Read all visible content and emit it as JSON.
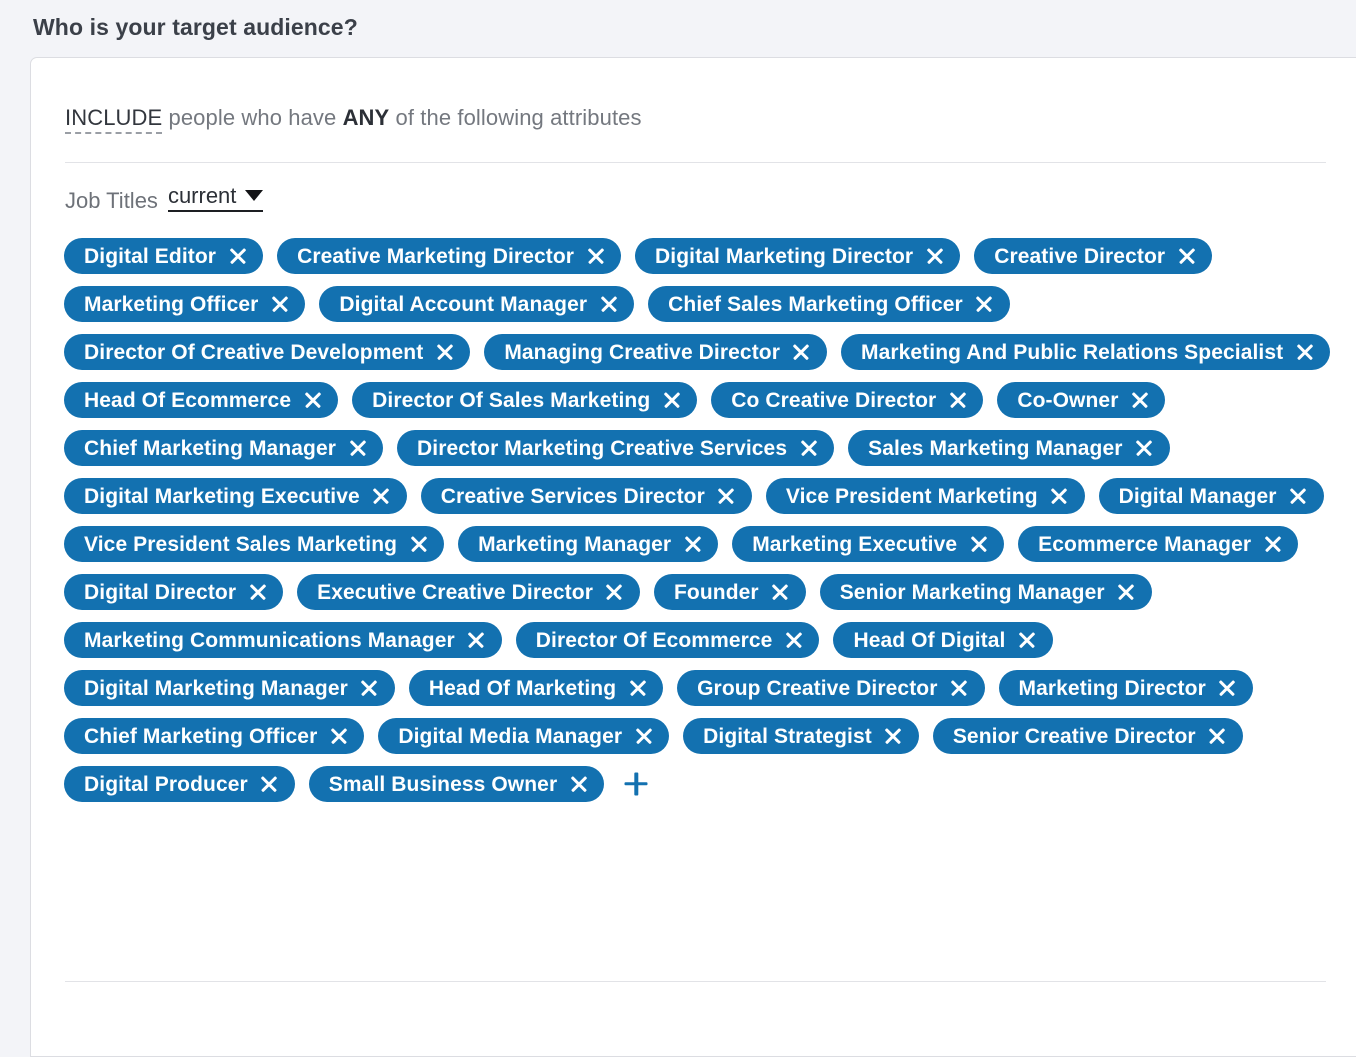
{
  "page": {
    "title": "Who is your target audience?"
  },
  "card": {
    "include_line": {
      "keyword_include": "INCLUDE",
      "text_middle": " people who have ",
      "keyword_any": "ANY",
      "text_tail": " of the following attributes"
    },
    "filter": {
      "label": "Job Titles",
      "scope_value": "current",
      "scope_icon": "chevron-down-icon",
      "add_icon": "plus-icon",
      "remove_icon": "close-icon"
    },
    "tags": [
      "Digital Editor",
      "Creative Marketing Director",
      "Digital Marketing Director",
      "Creative Director",
      "Marketing Officer",
      "Digital Account Manager",
      "Chief Sales Marketing Officer",
      "Director Of Creative Development",
      "Managing Creative Director",
      "Marketing And Public Relations Specialist",
      "Head Of Ecommerce",
      "Director Of Sales Marketing",
      "Co Creative Director",
      "Co-Owner",
      "Chief Marketing Manager",
      "Director Marketing Creative Services",
      "Sales Marketing Manager",
      "Digital Marketing Executive",
      "Creative Services Director",
      "Vice President Marketing",
      "Digital Manager",
      "Vice President Sales Marketing",
      "Marketing Manager",
      "Marketing Executive",
      "Ecommerce Manager",
      "Digital Director",
      "Executive Creative Director",
      "Founder",
      "Senior Marketing Manager",
      "Marketing Communications Manager",
      "Director Of Ecommerce",
      "Head Of Digital",
      "Digital Marketing Manager",
      "Head Of Marketing",
      "Group Creative Director",
      "Marketing Director",
      "Chief Marketing Officer",
      "Digital Media Manager",
      "Digital Strategist",
      "Senior Creative Director",
      "Digital Producer",
      "Small Business Owner"
    ]
  },
  "colors": {
    "accent": "#1371b0",
    "page_background": "#f3f4f8",
    "card_background": "#ffffff",
    "title_text": "#3b4049",
    "muted_text": "#6e7279"
  }
}
